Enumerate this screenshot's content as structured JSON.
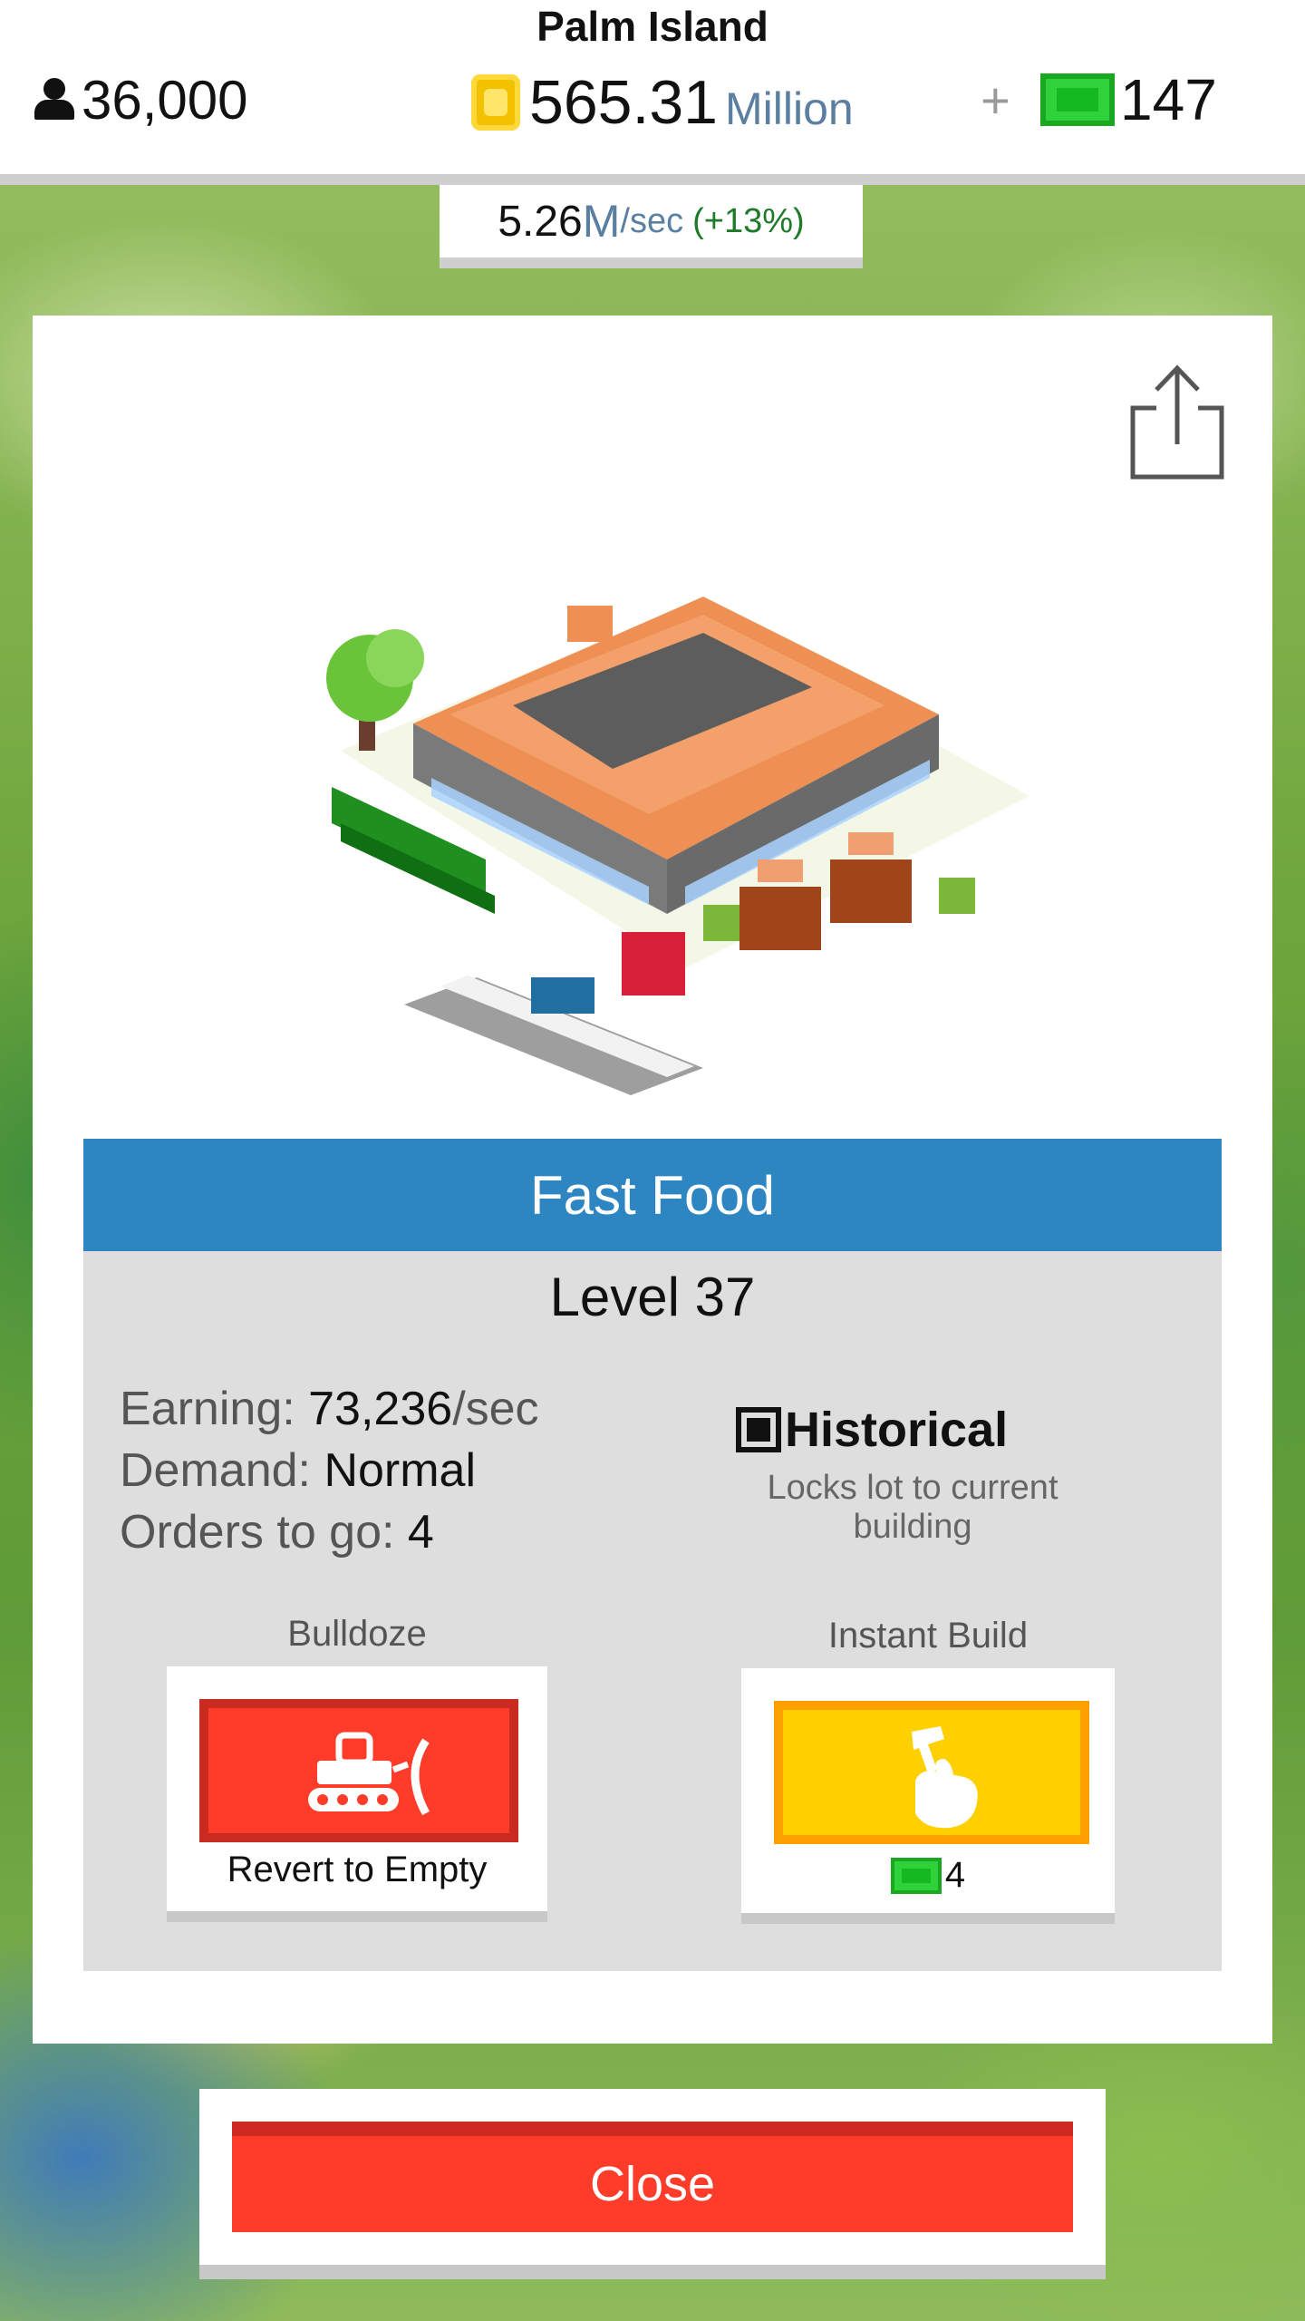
{
  "island": {
    "name": "Palm Island"
  },
  "topbar": {
    "population": "36,000",
    "money_value": "565.31",
    "money_unit": "Million",
    "plus": "+",
    "cash": "147"
  },
  "rate": {
    "value": "5.26",
    "unit_m": "M",
    "unit_sec": "/sec",
    "bonus": "(+13%)"
  },
  "building": {
    "name": "Fast Food",
    "level": "Level 37",
    "earning_label": "Earning: ",
    "earning_value": "73,236",
    "earning_unit": "/sec",
    "demand_label": "Demand: ",
    "demand_value": "Normal",
    "orders_label": "Orders to go: ",
    "orders_value": "4",
    "historical_label": "Historical",
    "historical_desc": "Locks lot to current building"
  },
  "actions": {
    "bulldoze_title": "Bulldoze",
    "bulldoze_label": "Revert to Empty",
    "instant_title": "Instant Build",
    "instant_cost": "4"
  },
  "close": {
    "label": "Close"
  },
  "colors": {
    "header_blue": "#2d85c2",
    "bulldoze_red": "#ff3b2a",
    "instant_yellow": "#ffd000",
    "cash_green": "#2fd23b",
    "coin_gold": "#f2c200"
  },
  "icons": [
    "person-icon",
    "coin-icon",
    "cash-icon",
    "share-icon",
    "checkbox-icon",
    "bulldozer-icon",
    "hammer-hand-icon"
  ]
}
